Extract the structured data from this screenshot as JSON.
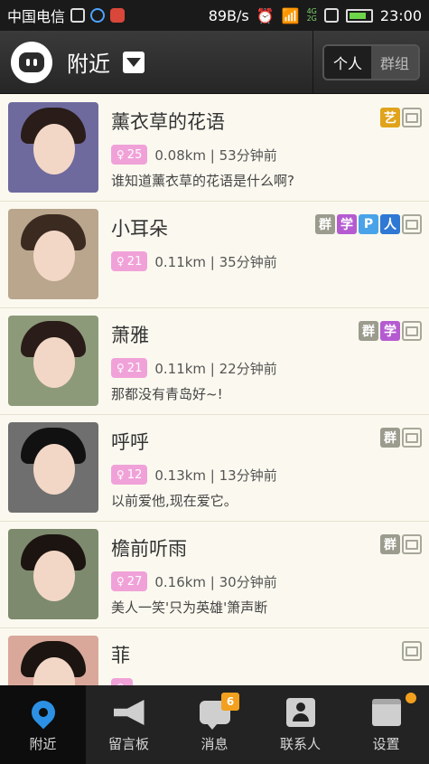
{
  "status_bar": {
    "carrier": "中国电信",
    "net_speed": "89B/s",
    "net_4g": "4G",
    "net_2g": "2G",
    "time": "23:00"
  },
  "header": {
    "title": "附近",
    "segment_personal": "个人",
    "segment_group": "群组"
  },
  "people": [
    {
      "name": "薰衣草的花语",
      "age": "25",
      "distance_time": "0.08km | 53分钟前",
      "signature": "谁知道薰衣草的花语是什么啊?",
      "tags": [
        "艺"
      ],
      "avatar_bg": "#6e6a9e",
      "hair": "#2a1c18"
    },
    {
      "name": "小耳朵",
      "age": "21",
      "distance_time": "0.11km | 35分钟前",
      "signature": "",
      "tags": [
        "群",
        "学",
        "P",
        "人"
      ],
      "avatar_bg": "#b9a68d",
      "hair": "#3a2a20"
    },
    {
      "name": "萧雅",
      "age": "21",
      "distance_time": "0.11km | 22分钟前",
      "signature": "那都没有青岛好~!",
      "tags": [
        "群",
        "学"
      ],
      "avatar_bg": "#8d9a7a",
      "hair": "#2a1c18"
    },
    {
      "name": "呼呼",
      "age": "12",
      "distance_time": "0.13km | 13分钟前",
      "signature": "以前爱他,现在爱它。",
      "tags": [
        "群"
      ],
      "avatar_bg": "#6f6f6f",
      "hair": "#111111"
    },
    {
      "name": "檐前听雨",
      "age": "27",
      "distance_time": "0.16km | 30分钟前",
      "signature": "美人一笑'只为英雄'箫声断",
      "tags": [
        "群"
      ],
      "avatar_bg": "#7d8a6e",
      "hair": "#1c1410"
    },
    {
      "name": "菲",
      "age": "",
      "distance_time": "",
      "signature": "",
      "tags": [],
      "avatar_bg": "#d9a89a",
      "hair": "#1c1410"
    }
  ],
  "tabbar": {
    "nearby": "附近",
    "message_board": "留言板",
    "messages": "消息",
    "messages_badge": "6",
    "contacts": "联系人",
    "settings": "设置"
  },
  "colors": {
    "accent_blue": "#2c91e5",
    "badge_orange": "#f2a01e",
    "age_pink": "#f0a2d8"
  }
}
